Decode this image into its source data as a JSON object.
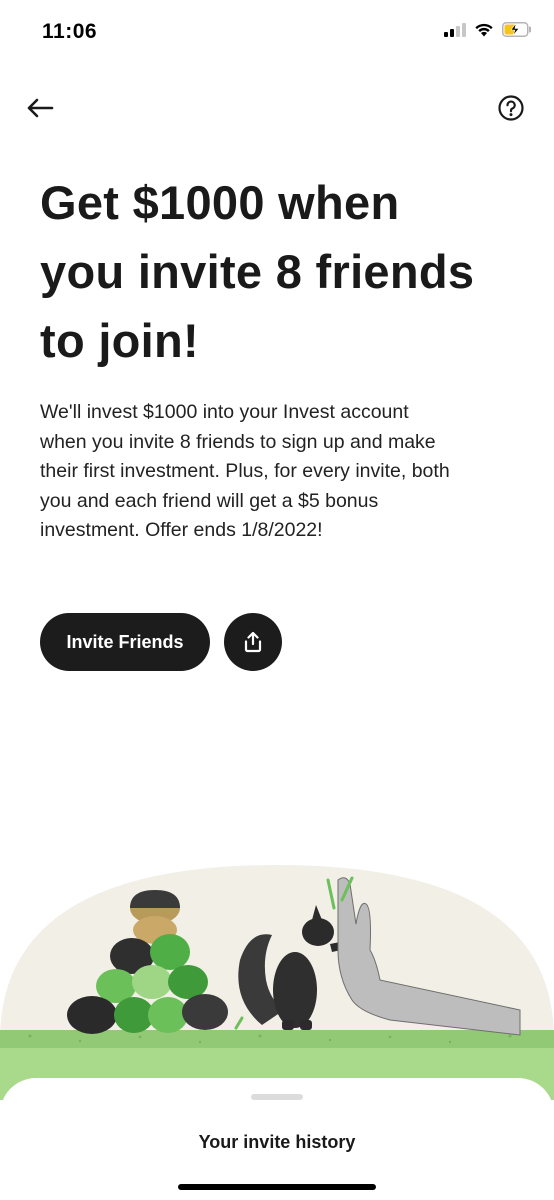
{
  "status_bar": {
    "time": "11:06",
    "signal_icon": "cellular-signal-icon",
    "wifi_icon": "wifi-icon",
    "battery_icon": "battery-charging-icon",
    "battery_color": "#f5c518"
  },
  "nav": {
    "back_icon": "arrow-left-icon",
    "help_icon": "question-mark-circle-icon"
  },
  "promo": {
    "headline_line1": "Get $1000 when",
    "headline_line2": "you invite 8 friends",
    "headline_line3": "to join!",
    "body_line1": "We'll invest $1000 into your Invest account",
    "body_line2": "when you invite 8 friends to sign up and make",
    "body_line3": "their first investment. Plus, for every invite, both",
    "body_line4": "you and each friend will get a $5 bonus",
    "body_line5": "investment. Offer ends 1/8/2022!"
  },
  "actions": {
    "invite_label": "Invite Friends",
    "share_icon": "share-upload-icon"
  },
  "illustration": {
    "subject": "squirrel-high-five-illustration",
    "accent_green": "#a9d98a",
    "dark_green": "#3f9a3a",
    "background_arc": "#f1efe6"
  },
  "bottom_sheet": {
    "title": "Your invite history"
  },
  "colors": {
    "primary_button": "#1c1c1c",
    "text": "#1a1a1a"
  }
}
